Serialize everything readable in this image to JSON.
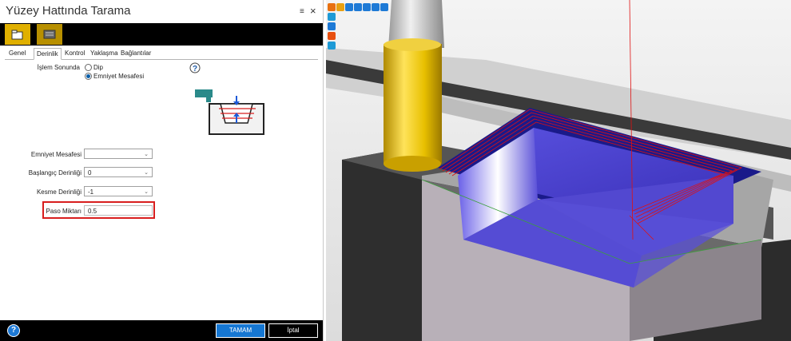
{
  "dialog": {
    "title": "Yüzey Hattında Tarama",
    "pin_icon": "pin-icon",
    "close_icon": "close-icon",
    "toolbar_buttons": [
      "folder-icon",
      "tool-icon"
    ],
    "tabs": [
      "Genel",
      "Derinlik",
      "Kontrol",
      "Yaklaşma",
      "Bağlantılar"
    ],
    "active_tab": "Derinlik",
    "end_label": "İşlem Sonunda",
    "radio_options": [
      "Dip",
      "Emniyet Mesafesi"
    ],
    "radio_selected": "Emniyet Mesafesi",
    "fields": {
      "safety": {
        "label": "Emniyet Mesafesi",
        "value": ""
      },
      "start_depth": {
        "label": "Başlangıç Derinliği",
        "value": "0"
      },
      "cut_depth": {
        "label": "Kesme Derinliği",
        "value": "-1"
      },
      "step": {
        "label": "Paso Miktarı",
        "value": "0.5"
      }
    },
    "ok_label": "TAMAM",
    "cancel_label": "İptal",
    "highlight_color": "#d81e1e",
    "accent_color": "#1677d2"
  },
  "viewport": {
    "icons": [
      "home-icon",
      "factory-icon",
      "stats-icon",
      "up-arrow-icon",
      "zoom-icon",
      "fit-icon",
      "pan-icon",
      "view-cube-icon",
      "rotate-icon",
      "shade-icon",
      "info-icon"
    ],
    "pocket_color": "#3d35c8",
    "toolpath_color": "#e01010",
    "tool_color": "#e8c000"
  }
}
